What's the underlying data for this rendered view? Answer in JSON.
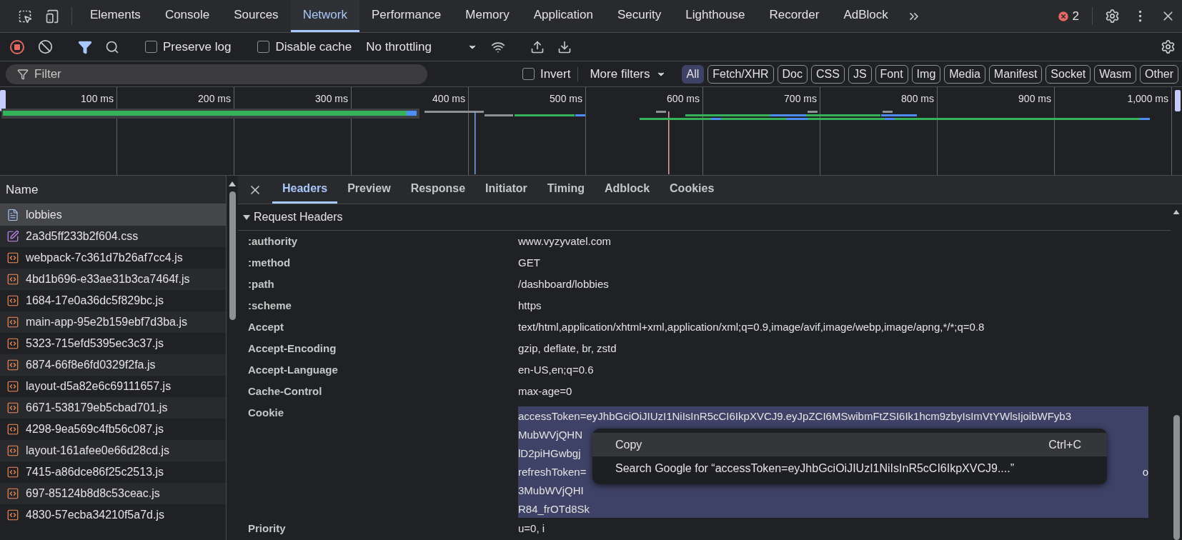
{
  "main_tabs": [
    {
      "label": "Elements",
      "selected": false
    },
    {
      "label": "Console",
      "selected": false
    },
    {
      "label": "Sources",
      "selected": false
    },
    {
      "label": "Network",
      "selected": true
    },
    {
      "label": "Performance",
      "selected": false
    },
    {
      "label": "Memory",
      "selected": false
    },
    {
      "label": "Application",
      "selected": false
    },
    {
      "label": "Security",
      "selected": false
    },
    {
      "label": "Lighthouse",
      "selected": false
    },
    {
      "label": "Recorder",
      "selected": false
    },
    {
      "label": "AdBlock",
      "selected": false
    }
  ],
  "error_count": "2",
  "toolbar": {
    "recording": true,
    "filter_active": true,
    "preserve_log": {
      "label": "Preserve log",
      "checked": false
    },
    "disable_cache": {
      "label": "Disable cache",
      "checked": false
    },
    "throttling": "No throttling"
  },
  "filter_bar": {
    "placeholder": "Filter",
    "invert": {
      "label": "Invert",
      "checked": false
    },
    "more_filters": "More filters",
    "types": [
      {
        "label": "All",
        "selected": true
      },
      {
        "label": "Fetch/XHR",
        "selected": false
      },
      {
        "label": "Doc",
        "selected": false
      },
      {
        "label": "CSS",
        "selected": false
      },
      {
        "label": "JS",
        "selected": false
      },
      {
        "label": "Font",
        "selected": false
      },
      {
        "label": "Img",
        "selected": false
      },
      {
        "label": "Media",
        "selected": false
      },
      {
        "label": "Manifest",
        "selected": false
      },
      {
        "label": "Socket",
        "selected": false
      },
      {
        "label": "Wasm",
        "selected": false
      },
      {
        "label": "Other",
        "selected": false
      }
    ]
  },
  "timeline": {
    "ticks": [
      "100 ms",
      "200 ms",
      "300 ms",
      "400 ms",
      "500 ms",
      "600 ms",
      "700 ms",
      "800 ms",
      "900 ms",
      "1,000 ms"
    ]
  },
  "requests": {
    "column": "Name",
    "rows": [
      {
        "name": "lobbies",
        "kind": "doc",
        "selected": true
      },
      {
        "name": "2a3d5ff233b2f604.css",
        "kind": "css",
        "selected": false
      },
      {
        "name": "webpack-7c361d7b26af7cc4.js",
        "kind": "js",
        "selected": false
      },
      {
        "name": "4bd1b696-e33ae31b3ca7464f.js",
        "kind": "js",
        "selected": false
      },
      {
        "name": "1684-17e0a36dc5f829bc.js",
        "kind": "js",
        "selected": false
      },
      {
        "name": "main-app-95e2b159ebf7d3ba.js",
        "kind": "js",
        "selected": false
      },
      {
        "name": "5323-715efd5395ec3c37.js",
        "kind": "js",
        "selected": false
      },
      {
        "name": "6874-66f8e6fd0329f2fa.js",
        "kind": "js",
        "selected": false
      },
      {
        "name": "layout-d5a82e6c69111657.js",
        "kind": "js",
        "selected": false
      },
      {
        "name": "6671-538179eb5cbad701.js",
        "kind": "js",
        "selected": false
      },
      {
        "name": "4298-9ea569c4fb56c087.js",
        "kind": "js",
        "selected": false
      },
      {
        "name": "layout-161afee0e66d28cd.js",
        "kind": "js",
        "selected": false
      },
      {
        "name": "7415-a86dce86f25c2513.js",
        "kind": "js",
        "selected": false
      },
      {
        "name": "697-85124b8d8c53ceac.js",
        "kind": "js",
        "selected": false
      },
      {
        "name": "4830-57ecba34210f5a7d.js",
        "kind": "js",
        "selected": false
      }
    ]
  },
  "details": {
    "tabs": [
      {
        "label": "Headers",
        "selected": true
      },
      {
        "label": "Preview",
        "selected": false
      },
      {
        "label": "Response",
        "selected": false
      },
      {
        "label": "Initiator",
        "selected": false
      },
      {
        "label": "Timing",
        "selected": false
      },
      {
        "label": "Adblock",
        "selected": false
      },
      {
        "label": "Cookies",
        "selected": false
      }
    ],
    "section": {
      "title": "Request Headers",
      "expanded": true
    },
    "headers": [
      {
        "name": ":authority",
        "value": "www.vyzyvatel.com"
      },
      {
        "name": ":method",
        "value": "GET"
      },
      {
        "name": ":path",
        "value": "/dashboard/lobbies"
      },
      {
        "name": ":scheme",
        "value": "https"
      },
      {
        "name": "Accept",
        "value": "text/html,application/xhtml+xml,application/xml;q=0.9,image/avif,image/webp,image/apng,*/*;q=0.8"
      },
      {
        "name": "Accept-Encoding",
        "value": "gzip, deflate, br, zstd"
      },
      {
        "name": "Accept-Language",
        "value": "en-US,en;q=0.6"
      },
      {
        "name": "Cache-Control",
        "value": "max-age=0"
      },
      {
        "name": "Cookie",
        "selected": true,
        "lines": [
          {
            "text": "accessToken=eyJhbGciOiJIUzI1NiIsInR5cCI6IkpXVCJ9.eyJpZCI6MSwibmFtZSI6Ik1hcm9zbyIsImVtYWlsIjoibWFyb3"
          },
          {
            "text": "MubWVjQHN"
          },
          {
            "text": "lD2piHGwbgj"
          },
          {
            "text": "refreshToken=",
            "tail": "o"
          },
          {
            "text": "3MubWVjQHI"
          },
          {
            "text": "R84_frOTd8Sk"
          }
        ]
      },
      {
        "name": "Priority",
        "value": "u=0, i"
      }
    ]
  },
  "context_menu": {
    "items": [
      {
        "label": "Copy",
        "shortcut": "Ctrl+C",
        "highlighted": true
      },
      {
        "label": "Search Google for “accessToken=eyJhbGciOiJIUzI1NiIsInR5cCI6IkpXVCJ9....”",
        "highlighted": false
      }
    ]
  }
}
